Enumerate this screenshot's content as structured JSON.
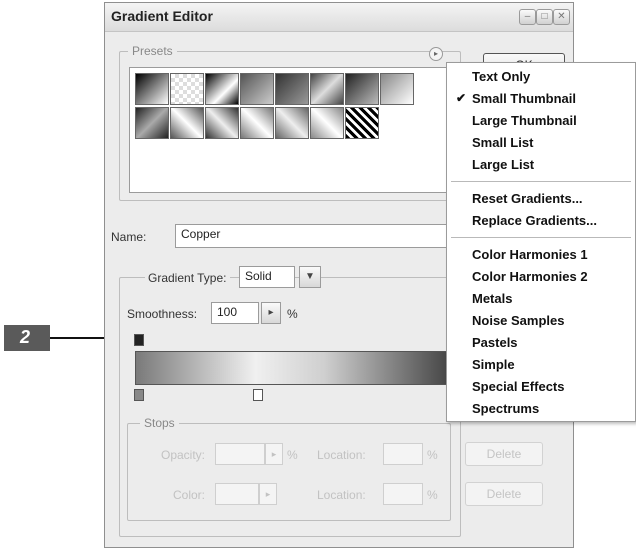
{
  "window": {
    "title": "Gradient Editor"
  },
  "presets": {
    "label": "Presets"
  },
  "ok_label": "OK",
  "name": {
    "label": "Name:",
    "value": "Copper"
  },
  "gradient_type": {
    "label": "Gradient Type:",
    "value": "Solid"
  },
  "smoothness": {
    "label": "Smoothness:",
    "value": "100",
    "unit": "%"
  },
  "stops": {
    "label": "Stops",
    "opacity_label": "Opacity:",
    "opacity_unit": "%",
    "location_label": "Location:",
    "location_unit": "%",
    "delete_label": "Delete",
    "color_label": "Color:",
    "location_label_2": "Location:",
    "location_unit_2": "%",
    "delete_label_2": "Delete"
  },
  "callout": {
    "number": "2"
  },
  "menu": {
    "items": [
      {
        "label": "Text Only"
      },
      {
        "label": "Small Thumbnail",
        "checked": true
      },
      {
        "label": "Large Thumbnail"
      },
      {
        "label": "Small List"
      },
      {
        "label": "Large List"
      },
      {
        "label": "Reset Gradients..."
      },
      {
        "label": "Replace Gradients..."
      },
      {
        "label": "Color Harmonies 1"
      },
      {
        "label": "Color Harmonies 2"
      },
      {
        "label": "Metals"
      },
      {
        "label": "Noise Samples"
      },
      {
        "label": "Pastels"
      },
      {
        "label": "Simple"
      },
      {
        "label": "Special Effects"
      },
      {
        "label": "Spectrums"
      }
    ]
  }
}
